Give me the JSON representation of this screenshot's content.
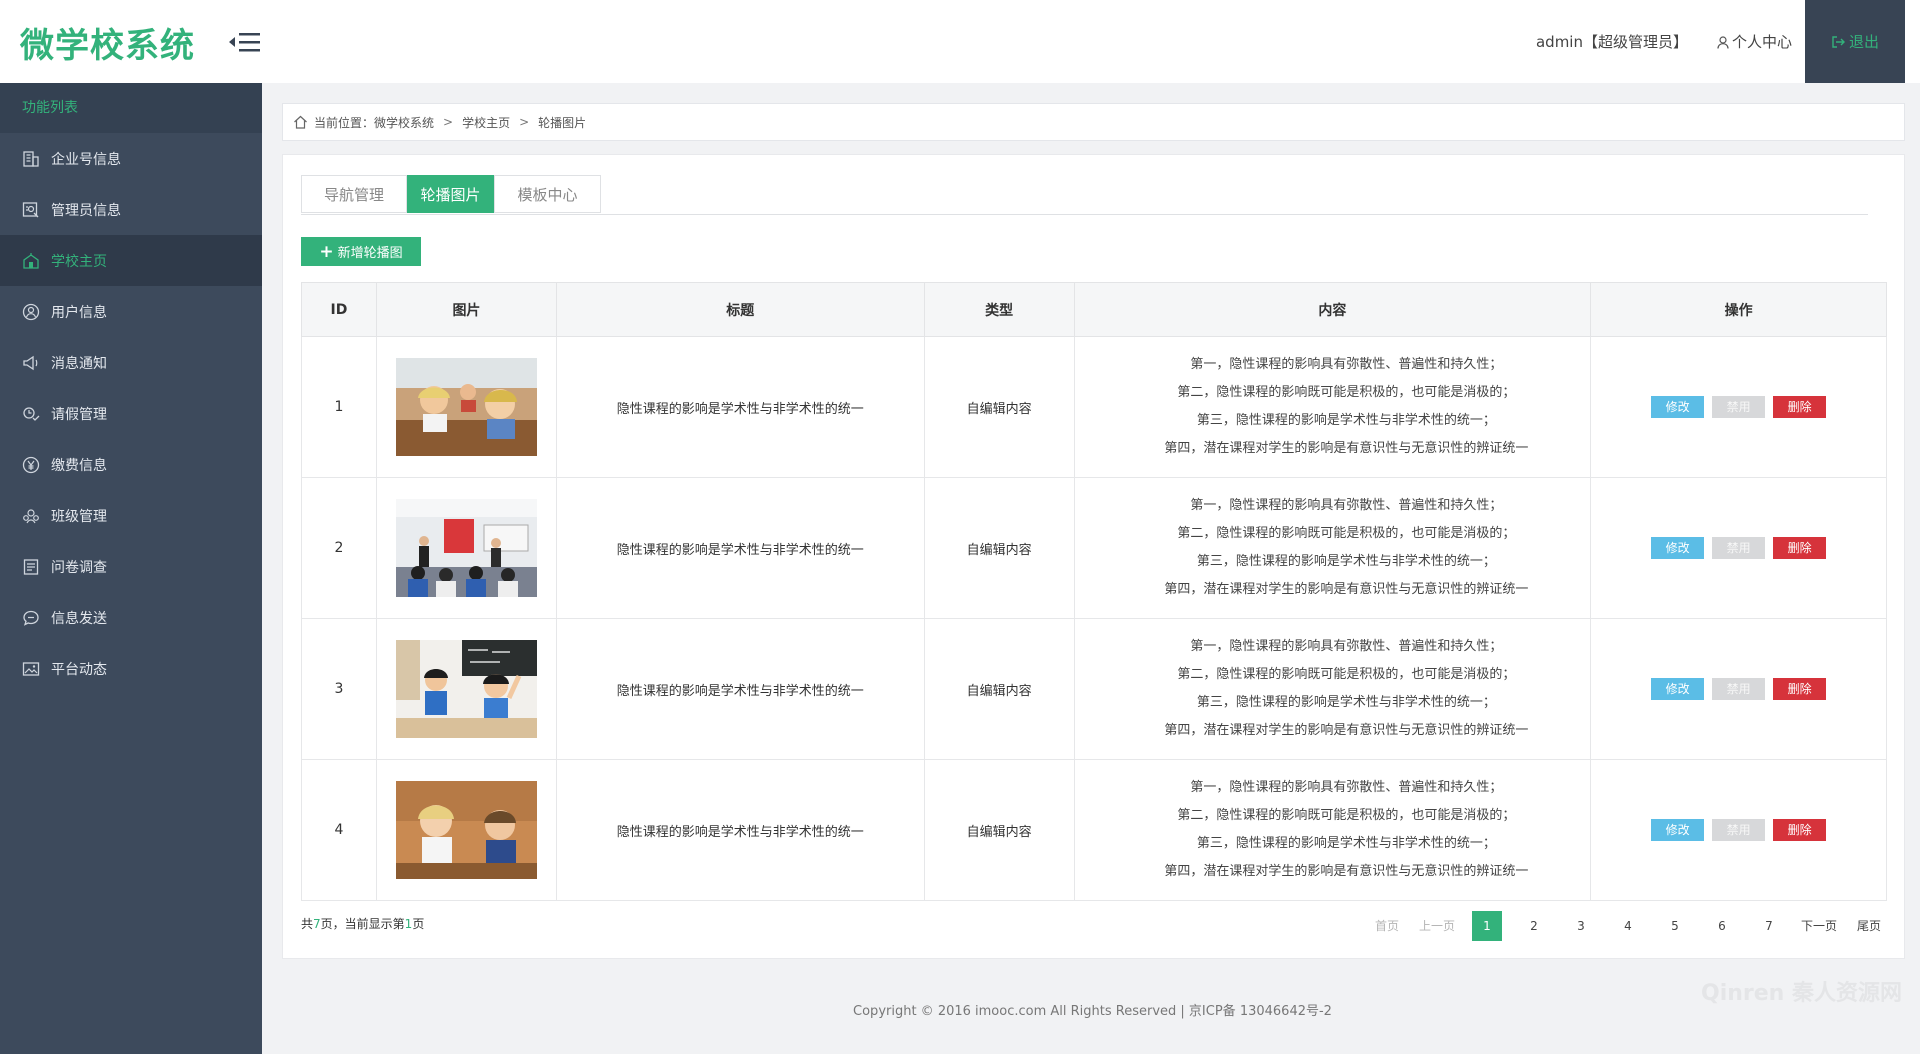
{
  "app": {
    "logo": "微学校系统"
  },
  "topbar": {
    "user": "admin【超级管理员】",
    "center": "个人中心",
    "logout": "退出"
  },
  "sidebar": {
    "header": "功能列表",
    "items": [
      {
        "label": "企业号信息",
        "icon": "building-icon"
      },
      {
        "label": "管理员信息",
        "icon": "id-card-icon"
      },
      {
        "label": "学校主页",
        "icon": "school-icon"
      },
      {
        "label": "用户信息",
        "icon": "user-icon"
      },
      {
        "label": "消息通知",
        "icon": "megaphone-icon"
      },
      {
        "label": "请假管理",
        "icon": "leave-icon"
      },
      {
        "label": "缴费信息",
        "icon": "payment-icon"
      },
      {
        "label": "班级管理",
        "icon": "class-icon"
      },
      {
        "label": "问卷调查",
        "icon": "survey-icon"
      },
      {
        "label": "信息发送",
        "icon": "chat-icon"
      },
      {
        "label": "平台动态",
        "icon": "image-icon"
      }
    ]
  },
  "breadcrumb": {
    "prefix": "当前位置：",
    "items": [
      "微学校系统",
      "学校主页",
      "轮播图片"
    ],
    "sep": ">"
  },
  "tabs": [
    {
      "label": "导航管理"
    },
    {
      "label": "轮播图片"
    },
    {
      "label": "模板中心"
    }
  ],
  "add_button": {
    "plus": "+",
    "label": "新增轮播图"
  },
  "table": {
    "headers": [
      "ID",
      "图片",
      "标题",
      "类型",
      "内容",
      "操作"
    ],
    "rows": [
      {
        "id": "1",
        "title": "隐性课程的影响是学术性与非学术性的统一",
        "type": "自编辑内容",
        "content": [
          "第一，隐性课程的影响具有弥散性、普遍性和持久性；",
          "第二，隐性课程的影响既可能是积极的，也可能是消极的；",
          "第三，隐性课程的影响是学术性与非学术性的统一；",
          "第四，潜在课程对学生的影响是有意识性与无意识性的辨证统一"
        ]
      },
      {
        "id": "2",
        "title": "隐性课程的影响是学术性与非学术性的统一",
        "type": "自编辑内容",
        "content": [
          "第一，隐性课程的影响具有弥散性、普遍性和持久性；",
          "第二，隐性课程的影响既可能是积极的，也可能是消极的；",
          "第三，隐性课程的影响是学术性与非学术性的统一；",
          "第四，潜在课程对学生的影响是有意识性与无意识性的辨证统一"
        ]
      },
      {
        "id": "3",
        "title": "隐性课程的影响是学术性与非学术性的统一",
        "type": "自编辑内容",
        "content": [
          "第一，隐性课程的影响具有弥散性、普遍性和持久性；",
          "第二，隐性课程的影响既可能是积极的，也可能是消极的；",
          "第三，隐性课程的影响是学术性与非学术性的统一；",
          "第四，潜在课程对学生的影响是有意识性与无意识性的辨证统一"
        ]
      },
      {
        "id": "4",
        "title": "隐性课程的影响是学术性与非学术性的统一",
        "type": "自编辑内容",
        "content": [
          "第一，隐性课程的影响具有弥散性、普遍性和持久性；",
          "第二，隐性课程的影响既可能是积极的，也可能是消极的；",
          "第三，隐性课程的影响是学术性与非学术性的统一；",
          "第四，潜在课程对学生的影响是有意识性与无意识性的辨证统一"
        ]
      }
    ],
    "actions": {
      "edit": "修改",
      "disable": "禁用",
      "delete": "删除"
    }
  },
  "pagination": {
    "info_prefix": "共",
    "total_pages": "7",
    "info_mid": "页，当前显示第",
    "current": "1",
    "info_suffix": "页",
    "first": "首页",
    "prev": "上一页",
    "pages": [
      "1",
      "2",
      "3",
      "4",
      "5",
      "6",
      "7"
    ],
    "next": "下一页",
    "last": "尾页"
  },
  "footer": {
    "text": "Copyright © 2016 imooc.com All Rights Reserved | 京ICP备 13046642号-2"
  },
  "watermark": {
    "text": "Qinren 秦人资源网"
  },
  "colors": {
    "accent": "#33b27b",
    "sidebar": "#3d4a5c",
    "edit": "#5bbde6",
    "disable": "#d7d8da",
    "delete": "#d6333b"
  }
}
